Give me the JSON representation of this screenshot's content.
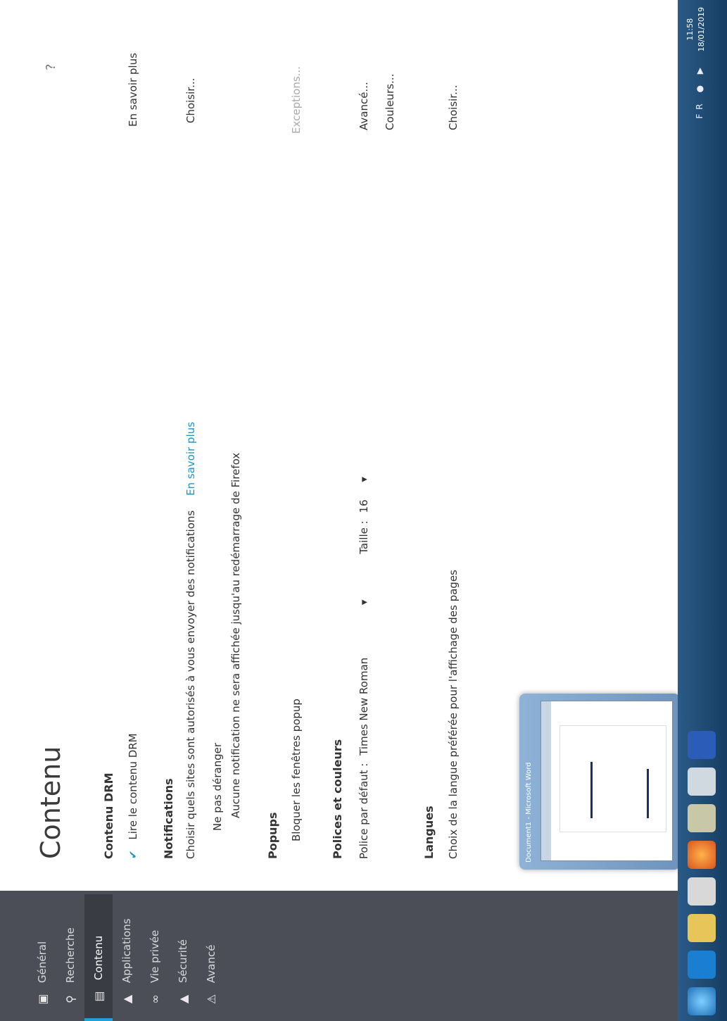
{
  "sidebar": {
    "items": [
      {
        "label": "Général",
        "icon": "general-icon",
        "active": false
      },
      {
        "label": "Recherche",
        "icon": "search-icon",
        "active": false
      },
      {
        "label": "Contenu",
        "icon": "content-icon",
        "active": true
      },
      {
        "label": "Applications",
        "icon": "applications-icon",
        "active": false
      },
      {
        "label": "Vie privée",
        "icon": "privacy-icon",
        "active": false
      },
      {
        "label": "Sécurité",
        "icon": "security-icon",
        "active": false
      },
      {
        "label": "Avancé",
        "icon": "advanced-icon",
        "active": false
      }
    ]
  },
  "main": {
    "title": "Contenu",
    "help": "?",
    "drm": {
      "heading": "Contenu DRM",
      "checkbox_label": "Lire le contenu DRM",
      "checked": true,
      "link": "En savoir plus"
    },
    "notifications": {
      "heading": "Notifications",
      "description": "Choisir quels sites sont autorisés à vous envoyer des notifications",
      "link": "En savoir plus",
      "choose_button": "Choisir...",
      "dnd_label": "Ne pas déranger",
      "dnd_description": "Aucune notification ne sera affichée jusqu'au redémarrage de Firefox"
    },
    "popups": {
      "heading": "Popups",
      "block_label": "Bloquer les fenêtres popup",
      "exceptions_button": "Exceptions..."
    },
    "fonts": {
      "heading": "Polices et couleurs",
      "default_font_label": "Police par défaut :",
      "default_font_value": "Times New Roman",
      "size_label": "Taille :",
      "size_value": "16",
      "advanced_button": "Avancé...",
      "colors_button": "Couleurs..."
    },
    "languages": {
      "heading": "Langues",
      "description": "Choix de la langue préférée pour l'affichage des pages",
      "choose_button": "Choisir..."
    }
  },
  "taskbar": {
    "thumbnail_title": "Document1 - Microsoft Word",
    "clock_time": "11:58",
    "clock_date": "18/01/2019",
    "tray_lang": "FR"
  },
  "colors": {
    "sidebar_bg": "#4b4e57",
    "accent": "#1e94c8",
    "taskbar": "#1f4d78"
  }
}
